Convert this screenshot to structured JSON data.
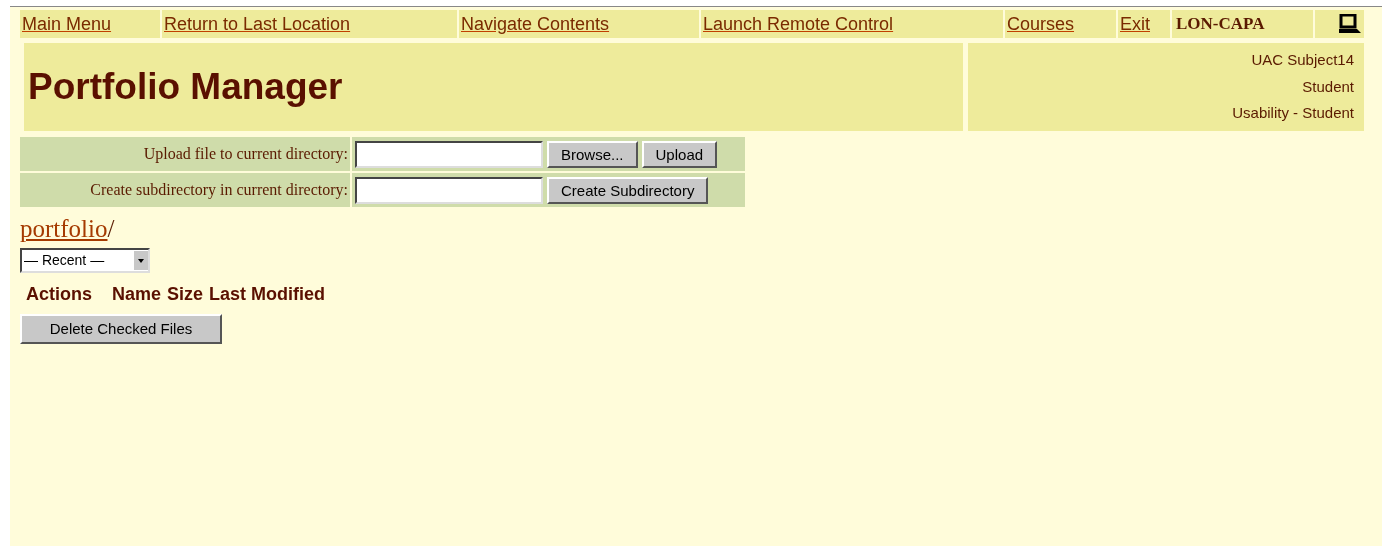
{
  "nav": [
    {
      "label": "Main Menu"
    },
    {
      "label": "Return to Last Location"
    },
    {
      "label": "Navigate Contents"
    },
    {
      "label": "Launch Remote Control"
    },
    {
      "label": "Courses"
    },
    {
      "label": "Exit"
    }
  ],
  "brand": "LON-CAPA",
  "title": "Portfolio Manager",
  "user": [
    "UAC Subject14",
    "Student",
    "Usability - Student"
  ],
  "forms": [
    {
      "label": "Upload file to current directory:",
      "buttons": [
        "Browse...",
        "Upload"
      ]
    },
    {
      "label": "Create subdirectory in current directory:",
      "buttons": [
        "Create Subdirectory"
      ]
    }
  ],
  "path": {
    "link": "portfolio",
    "separator": "/"
  },
  "recent": {
    "value": "— Recent —"
  },
  "columns": [
    "Actions",
    "Name",
    "Size",
    "Last Modified"
  ],
  "delete_button": "Delete Checked Files"
}
